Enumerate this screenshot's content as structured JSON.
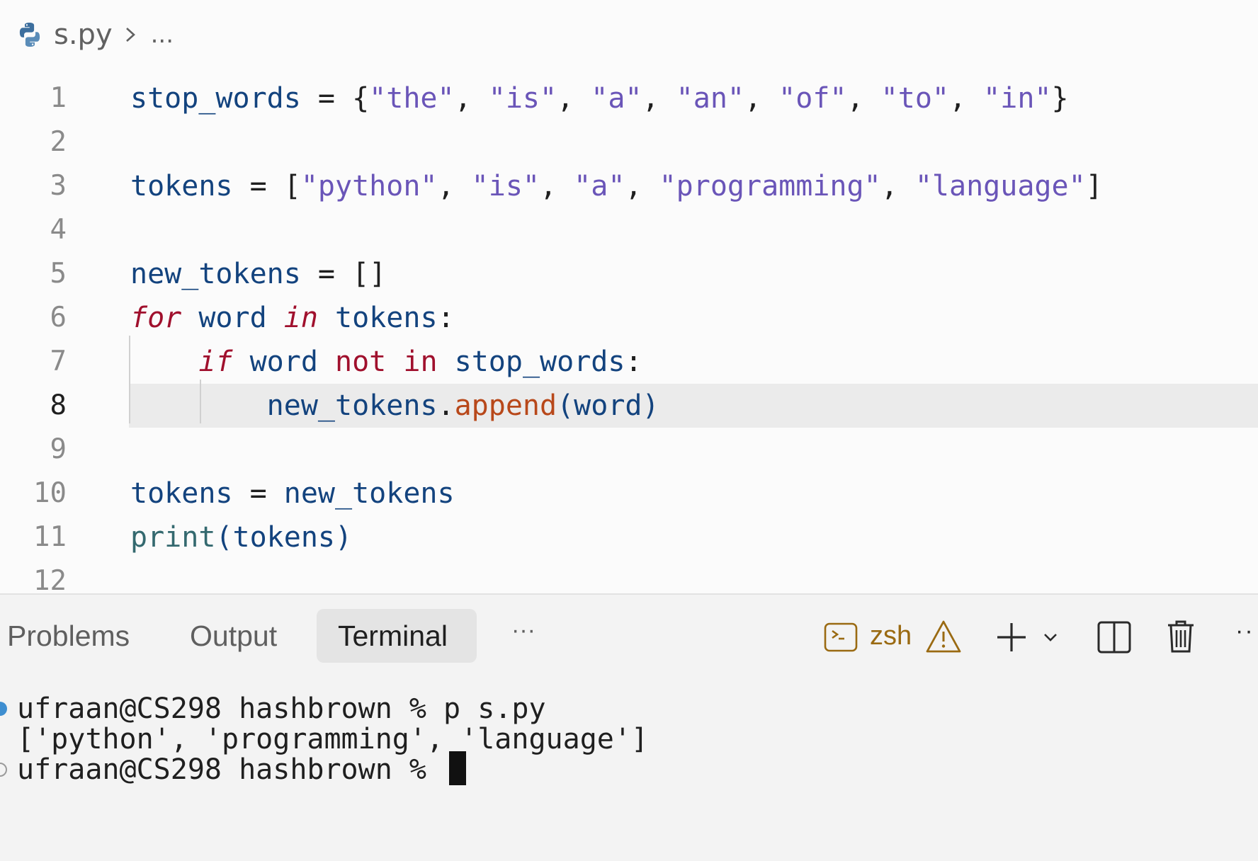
{
  "breadcrumb": {
    "file": "s.py",
    "more": "..."
  },
  "editor": {
    "current_line": 8,
    "lines": [
      {
        "n": "1",
        "tokens": [
          [
            "tk-var",
            "stop_words"
          ],
          [
            "tk-p",
            " = {"
          ],
          [
            "tk-str",
            "\"the\""
          ],
          [
            "tk-p",
            ", "
          ],
          [
            "tk-str",
            "\"is\""
          ],
          [
            "tk-p",
            ", "
          ],
          [
            "tk-str",
            "\"a\""
          ],
          [
            "tk-p",
            ", "
          ],
          [
            "tk-str",
            "\"an\""
          ],
          [
            "tk-p",
            ", "
          ],
          [
            "tk-str",
            "\"of\""
          ],
          [
            "tk-p",
            ", "
          ],
          [
            "tk-str",
            "\"to\""
          ],
          [
            "tk-p",
            ", "
          ],
          [
            "tk-str",
            "\"in\""
          ],
          [
            "tk-p",
            "}"
          ]
        ]
      },
      {
        "n": "2",
        "tokens": []
      },
      {
        "n": "3",
        "tokens": [
          [
            "tk-var",
            "tokens"
          ],
          [
            "tk-p",
            " = ["
          ],
          [
            "tk-str",
            "\"python\""
          ],
          [
            "tk-p",
            ", "
          ],
          [
            "tk-str",
            "\"is\""
          ],
          [
            "tk-p",
            ", "
          ],
          [
            "tk-str",
            "\"a\""
          ],
          [
            "tk-p",
            ", "
          ],
          [
            "tk-str",
            "\"programming\""
          ],
          [
            "tk-p",
            ", "
          ],
          [
            "tk-str",
            "\"language\""
          ],
          [
            "tk-p",
            "]"
          ]
        ]
      },
      {
        "n": "4",
        "tokens": []
      },
      {
        "n": "5",
        "tokens": [
          [
            "tk-var",
            "new_tokens"
          ],
          [
            "tk-p",
            " = []"
          ]
        ]
      },
      {
        "n": "6",
        "tokens": [
          [
            "tk-kw",
            "for"
          ],
          [
            "tk-p",
            " "
          ],
          [
            "tk-var",
            "word"
          ],
          [
            "tk-p",
            " "
          ],
          [
            "tk-kw",
            "in"
          ],
          [
            "tk-p",
            " "
          ],
          [
            "tk-var",
            "tokens"
          ],
          [
            "tk-p",
            ":"
          ]
        ]
      },
      {
        "n": "7",
        "tokens": [
          [
            "tk-p",
            "    "
          ],
          [
            "tk-kw",
            "if"
          ],
          [
            "tk-p",
            " "
          ],
          [
            "tk-var",
            "word"
          ],
          [
            "tk-p",
            " "
          ],
          [
            "tk-kwn",
            "not"
          ],
          [
            "tk-p",
            " "
          ],
          [
            "tk-kwn",
            "in"
          ],
          [
            "tk-p",
            " "
          ],
          [
            "tk-var",
            "stop_words"
          ],
          [
            "tk-p",
            ":"
          ]
        ]
      },
      {
        "n": "8",
        "tokens": [
          [
            "tk-p",
            "        "
          ],
          [
            "tk-var",
            "new_tokens"
          ],
          [
            "tk-p",
            "."
          ],
          [
            "tk-fn",
            "append"
          ],
          [
            "tk-var",
            "(word)"
          ]
        ]
      },
      {
        "n": "9",
        "tokens": []
      },
      {
        "n": "10",
        "tokens": [
          [
            "tk-var",
            "tokens"
          ],
          [
            "tk-p",
            " = "
          ],
          [
            "tk-var",
            "new_tokens"
          ]
        ]
      },
      {
        "n": "11",
        "tokens": [
          [
            "tk-bi",
            "print"
          ],
          [
            "tk-var",
            "(tokens)"
          ]
        ]
      },
      {
        "n": "12",
        "tokens": []
      }
    ]
  },
  "panel": {
    "tabs": [
      {
        "label": "Problems",
        "active": false
      },
      {
        "label": "Output",
        "active": false
      },
      {
        "label": "Terminal",
        "active": true
      }
    ],
    "more": "···",
    "shell": "zsh",
    "right_more": "··"
  },
  "terminal": {
    "lines": [
      {
        "text": "ufraan@CS298 hashbrown % p s.py",
        "dot": "#3e8ed0"
      },
      {
        "text": "['python', 'programming', 'language']",
        "dot": ""
      },
      {
        "text": "ufraan@CS298 hashbrown % ",
        "dot": "#9a9a9a",
        "cursor": true
      }
    ]
  },
  "colors": {
    "accent_warning": "#9a6a12",
    "keyword": "#a0102d",
    "string": "#6a55b8",
    "variable": "#13437e",
    "method": "#b8481a",
    "builtin": "#34696f"
  }
}
